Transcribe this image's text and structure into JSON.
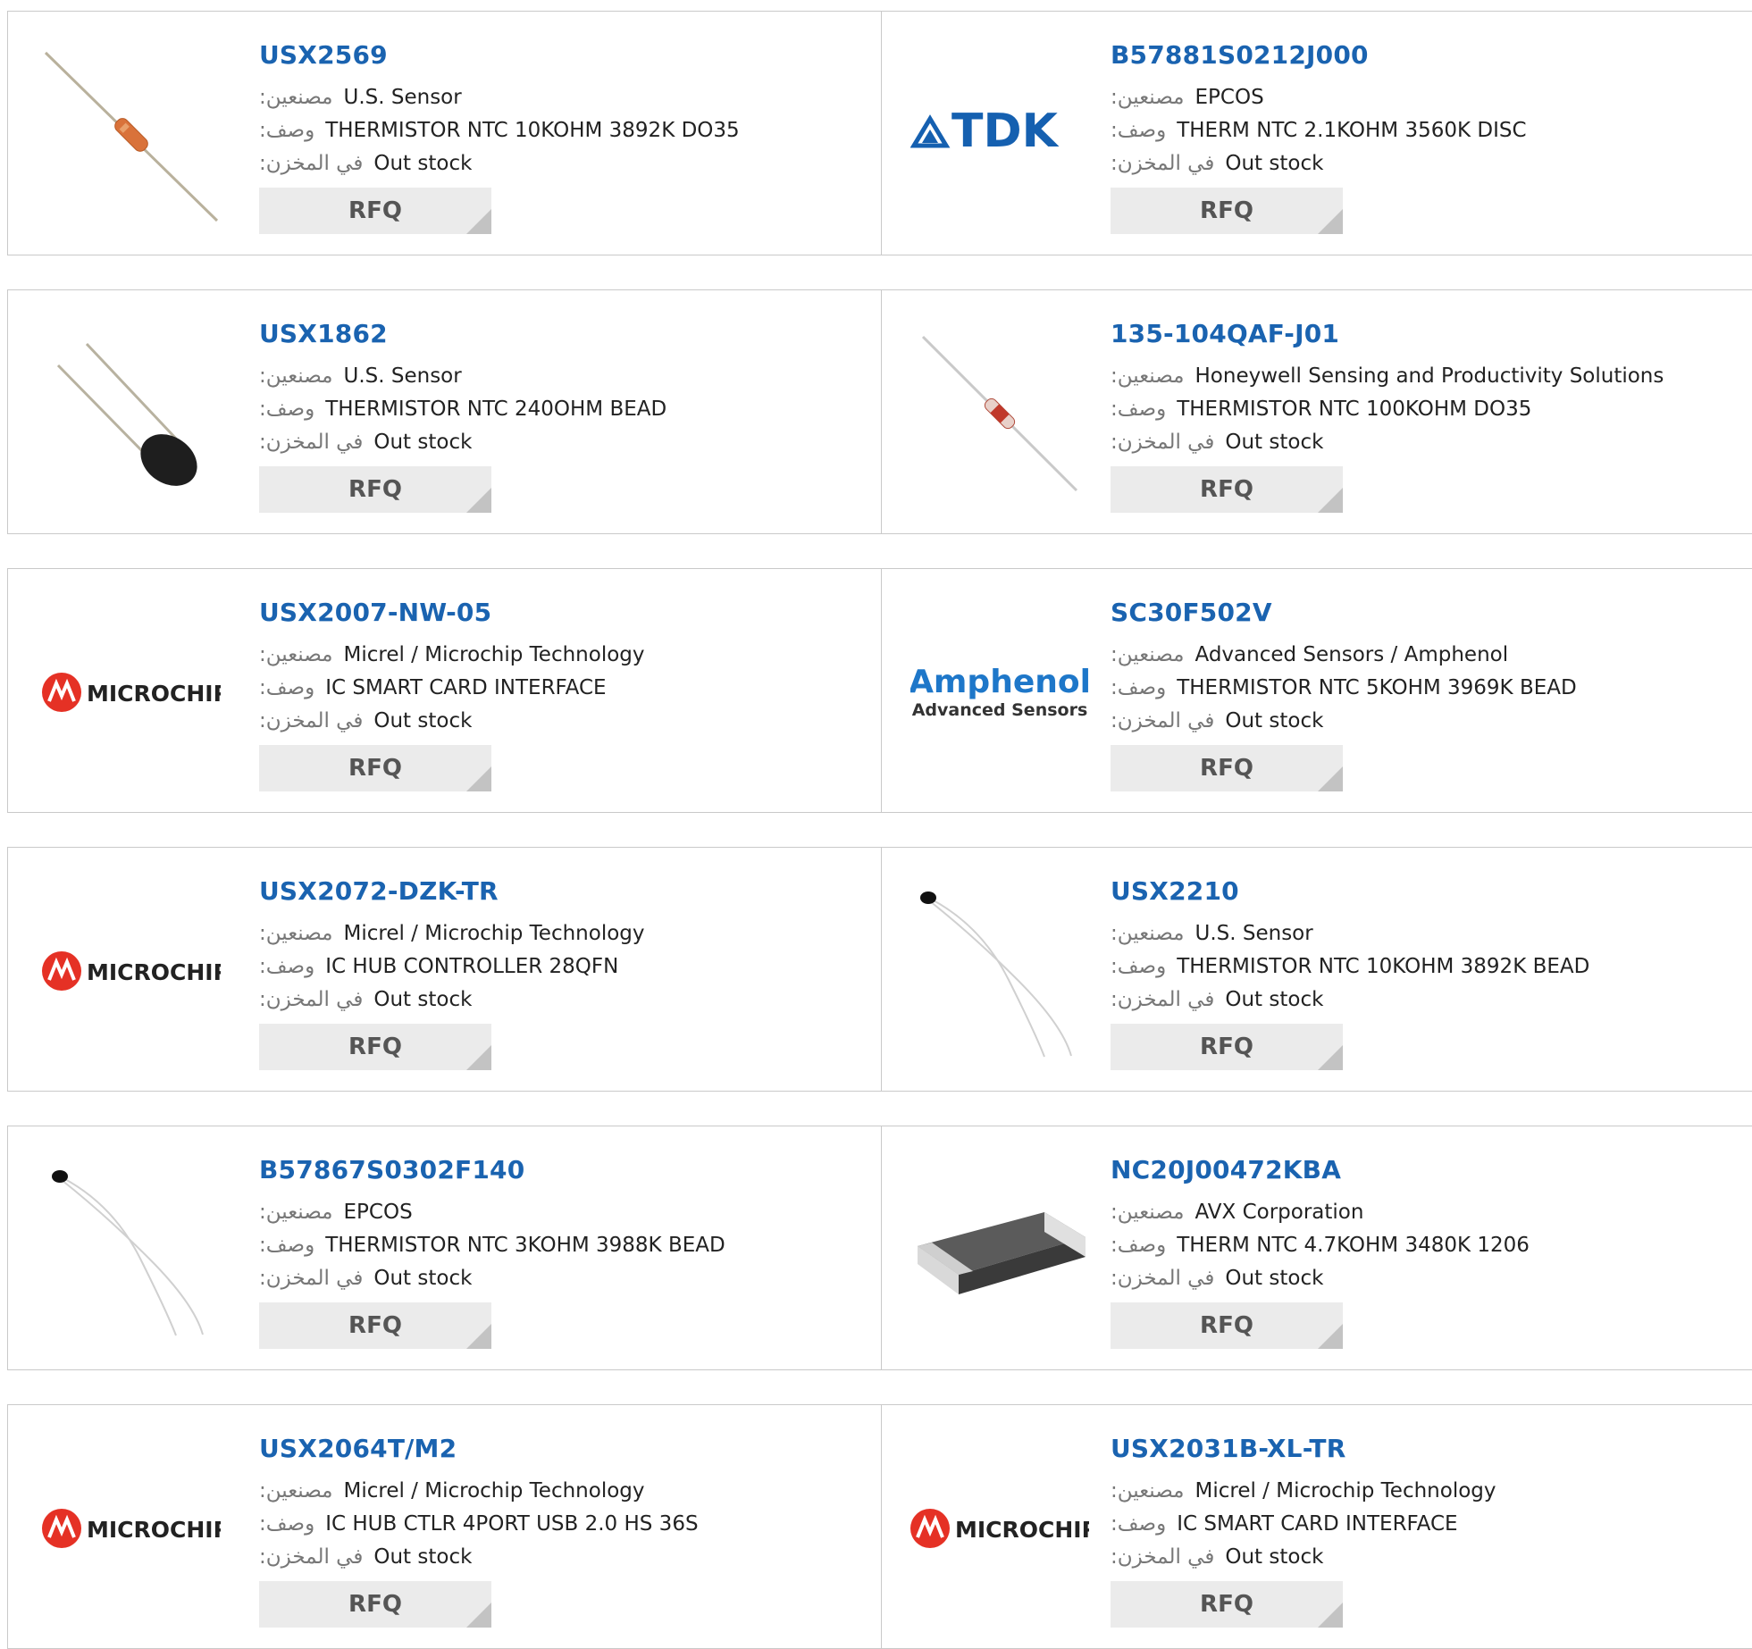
{
  "labels": {
    "manufacturer": ":مصنعين",
    "description": ":وصف",
    "stock": ":في المخزن"
  },
  "colors": {
    "part_link": "#1a63b0",
    "rfq_bg": "#ebebeb",
    "border": "#c9c9c9",
    "tdk_blue": "#1560b0",
    "microchip_red": "#e53125",
    "amphenol_blue": "#1e77c9"
  },
  "products": [
    {
      "part": "USX2569",
      "manufacturer": "U.S. Sensor",
      "description": "THERMISTOR NTC 10KOHM 3892K DO35",
      "stock": "Out stock",
      "rfq": "RFQ",
      "image": "axial-thermistor-orange"
    },
    {
      "part": "B57881S0212J000",
      "manufacturer": "EPCOS",
      "description": "THERM NTC 2.1KOHM 3560K DISC",
      "stock": "Out stock",
      "rfq": "RFQ",
      "image": "tdk-logo"
    },
    {
      "part": "USX1862",
      "manufacturer": "U.S. Sensor",
      "description": "THERMISTOR NTC 240OHM BEAD",
      "stock": "Out stock",
      "rfq": "RFQ",
      "image": "bead-thermistor-black"
    },
    {
      "part": "135-104QAF-J01",
      "manufacturer": "Honeywell Sensing and Productivity Solutions",
      "description": "THERMISTOR NTC 100KOHM DO35",
      "stock": "Out stock",
      "rfq": "RFQ",
      "image": "axial-thermistor-red"
    },
    {
      "part": "USX2007-NW-05",
      "manufacturer": "Micrel / Microchip Technology",
      "description": "IC SMART CARD INTERFACE",
      "stock": "Out stock",
      "rfq": "RFQ",
      "image": "microchip-logo"
    },
    {
      "part": "SC30F502V",
      "manufacturer": "Advanced Sensors / Amphenol",
      "description": "THERMISTOR NTC 5KOHM 3969K BEAD",
      "stock": "Out stock",
      "rfq": "RFQ",
      "image": "amphenol-logo"
    },
    {
      "part": "USX2072-DZK-TR",
      "manufacturer": "Micrel / Microchip Technology",
      "description": "IC HUB CONTROLLER 28QFN",
      "stock": "Out stock",
      "rfq": "RFQ",
      "image": "microchip-logo"
    },
    {
      "part": "USX2210",
      "manufacturer": "U.S. Sensor",
      "description": "THERMISTOR NTC 10KOHM 3892K BEAD",
      "stock": "Out stock",
      "rfq": "RFQ",
      "image": "wire-lead-thermistor"
    },
    {
      "part": "B57867S0302F140",
      "manufacturer": "EPCOS",
      "description": "THERMISTOR NTC 3KOHM 3988K BEAD",
      "stock": "Out stock",
      "rfq": "RFQ",
      "image": "wire-lead-thermistor"
    },
    {
      "part": "NC20J00472KBA",
      "manufacturer": "AVX Corporation",
      "description": "THERM NTC 4.7KOHM 3480K 1206",
      "stock": "Out stock",
      "rfq": "RFQ",
      "image": "smd-chip-1206"
    },
    {
      "part": "USX2064T/M2",
      "manufacturer": "Micrel / Microchip Technology",
      "description": "IC HUB CTLR 4PORT USB 2.0 HS 36S",
      "stock": "Out stock",
      "rfq": "RFQ",
      "image": "microchip-logo"
    },
    {
      "part": "USX2031B-XL-TR",
      "manufacturer": "Micrel / Microchip Technology",
      "description": "IC SMART CARD INTERFACE",
      "stock": "Out stock",
      "rfq": "RFQ",
      "image": "microchip-logo"
    }
  ],
  "logo_text": {
    "tdk": "TDK",
    "microchip": "MICROCHIP",
    "amphenol": "Amphenol",
    "amphenol_sub": "Advanced Sensors"
  }
}
